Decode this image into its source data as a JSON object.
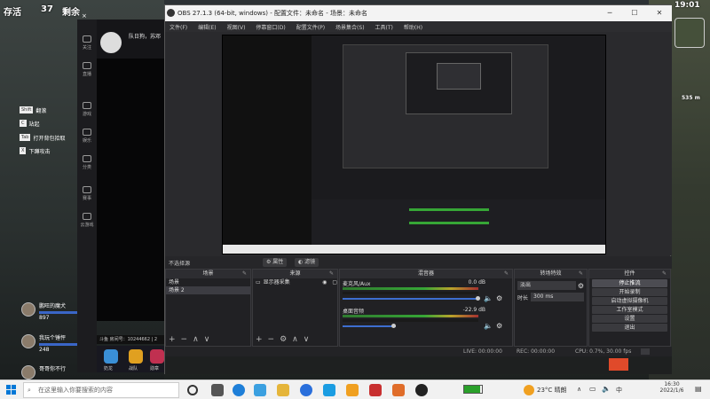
{
  "game": {
    "alive_label": "存活",
    "alive_count": "37",
    "remain_label": "剩余",
    "fps_corner": "19:01",
    "distance": "535 m",
    "killfeed": [
      {
        "tag": "Shift",
        "text": "翻滚"
      },
      {
        "tag": "C",
        "text": "站起"
      },
      {
        "tag": "Tab",
        "text": "打开背包拾取"
      },
      {
        "tag": "X",
        "text": "下蹲攻击"
      }
    ],
    "teammates": [
      {
        "name": "鹏旺的魔犬",
        "hp": "897"
      },
      {
        "name": "我玩个锤怦",
        "hp": "248"
      },
      {
        "name": "哥哥你不行",
        "hp": ""
      }
    ]
  },
  "huya": {
    "streamer_name": "队日狗，苏邓",
    "side_items": [
      "关注",
      "直播",
      "游戏",
      "娱乐",
      "分类",
      "赛事",
      "云游戏"
    ],
    "room_info": "斗鱼 房间号：10244662 | 2",
    "gift_labels": [
      "奶龙",
      "战队",
      "勋章",
      "超值大厅"
    ]
  },
  "obs": {
    "title": "OBS 27.1.3 (64-bit, windows) - 配置文件：未命名 - 场景：未命名",
    "menu": [
      "文件(F)",
      "编辑(E)",
      "视图(V)",
      "停靠窗口(D)",
      "配置文件(P)",
      "场景集合(S)",
      "工具(T)",
      "帮助(H)"
    ],
    "scene_bar_label": "不选择源",
    "properties_btn": "属性",
    "filters_btn": "滤镜",
    "panels": {
      "scenes": {
        "title": "场景",
        "items": [
          "场景",
          "场景 2"
        ]
      },
      "sources": {
        "title": "来源",
        "items": [
          "显示器采集"
        ]
      },
      "mixer": {
        "title": "混音器",
        "channels": [
          {
            "name": "麦克风/Aux",
            "db": "0.0 dB"
          },
          {
            "name": "桌面音频",
            "db": "-22.9 dB"
          }
        ]
      },
      "transitions": {
        "title": "转场特效",
        "type": "淡出",
        "duration_label": "时长",
        "duration_value": "300 ms"
      },
      "controls": {
        "title": "控件",
        "buttons": [
          "停止推流",
          "开始录制",
          "启动虚拟摄像机",
          "工作室模式",
          "设置",
          "退出"
        ]
      }
    },
    "status": {
      "live": "LIVE: 00:00:00",
      "rec": "REC: 00:00:00",
      "cpu": "CPU: 0.7%, 30.00 fps"
    }
  },
  "taskbar": {
    "search_placeholder": "在这里输入你要搜索的内容",
    "weather": "23°C 晴朗",
    "time": "16:30",
    "date": "2022/1/6",
    "lang": "中"
  },
  "colors": {
    "accent": "#3d6ecf",
    "obs_bg": "#2a2a2d",
    "taskbar": "#f1f1f1"
  }
}
